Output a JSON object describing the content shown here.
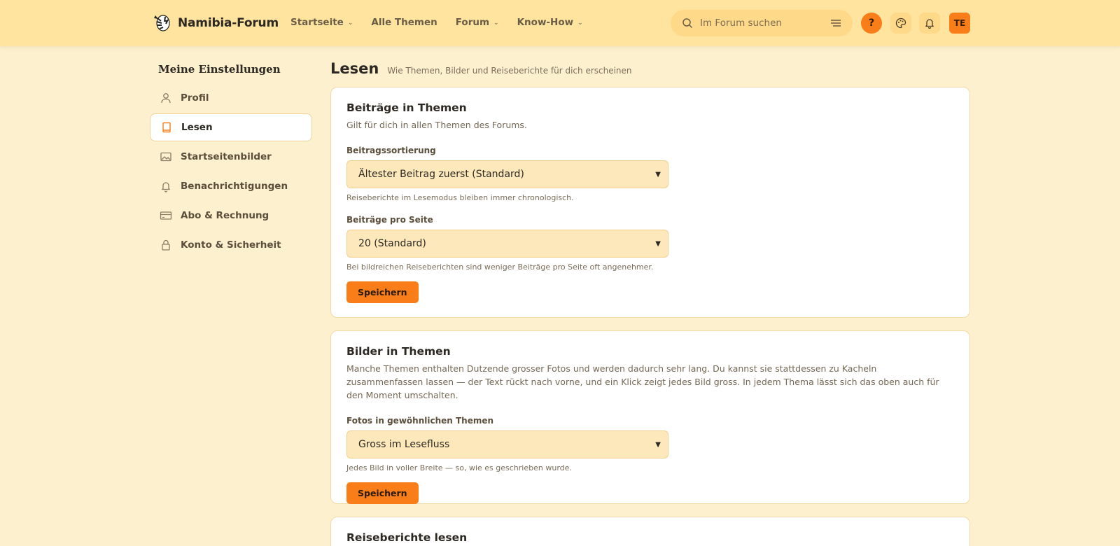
{
  "header": {
    "logo_text": "Namibia-Forum",
    "nav": [
      {
        "label": "Startseite",
        "dropdown": true
      },
      {
        "label": "Alle Themen",
        "dropdown": false
      },
      {
        "label": "Forum",
        "dropdown": true
      },
      {
        "label": "Know-How",
        "dropdown": true
      }
    ],
    "search_placeholder": "Im Forum suchen",
    "help_label": "?",
    "avatar_initials": "TE"
  },
  "sidebar": {
    "title": "Meine Einstellungen",
    "items": [
      {
        "label": "Profil",
        "icon": "user-icon",
        "active": false
      },
      {
        "label": "Lesen",
        "icon": "book-icon",
        "active": true
      },
      {
        "label": "Startseitenbilder",
        "icon": "image-icon",
        "active": false
      },
      {
        "label": "Benachrichtigungen",
        "icon": "bell-icon",
        "active": false
      },
      {
        "label": "Abo & Rechnung",
        "icon": "credit-card-icon",
        "active": false
      },
      {
        "label": "Konto & Sicherheit",
        "icon": "lock-icon",
        "active": false
      }
    ]
  },
  "main": {
    "title": "Lesen",
    "subtitle": "Wie Themen, Bilder und Reiseberichte für dich erscheinen",
    "card1": {
      "title": "Beiträge in Themen",
      "desc": "Gilt für dich in allen Themen des Forums.",
      "sort_label": "Beitragssortierung",
      "sort_value": "Ältester Beitrag zuerst (Standard)",
      "sort_hint": "Reiseberichte im Lesemodus bleiben immer chronologisch.",
      "per_page_label": "Beiträge pro Seite",
      "per_page_value": "20 (Standard)",
      "per_page_hint": "Bei bildreichen Reiseberichten sind weniger Beiträge pro Seite oft angenehmer.",
      "save": "Speichern"
    },
    "card2": {
      "title": "Bilder in Themen",
      "desc": "Manche Themen enthalten Dutzende grosser Fotos und werden dadurch sehr lang. Du kannst sie stattdessen zu Kacheln zusammenfassen lassen — der Text rückt nach vorne, und ein Klick zeigt jedes Bild gross. In jedem Thema lässt sich das oben auch für den Moment umschalten.",
      "photos_label": "Fotos in gewöhnlichen Themen",
      "photos_value": "Gross im Lesefluss",
      "photos_hint": "Jedes Bild in voller Breite — so, wie es geschrieben wurde.",
      "save": "Speichern"
    },
    "card3": {
      "title": "Reiseberichte lesen"
    }
  },
  "colors": {
    "accent": "#f97d18",
    "header_bg": "#ffe4a0",
    "page_bg": "#fdf0cf",
    "select_bg": "#fde8bb"
  }
}
